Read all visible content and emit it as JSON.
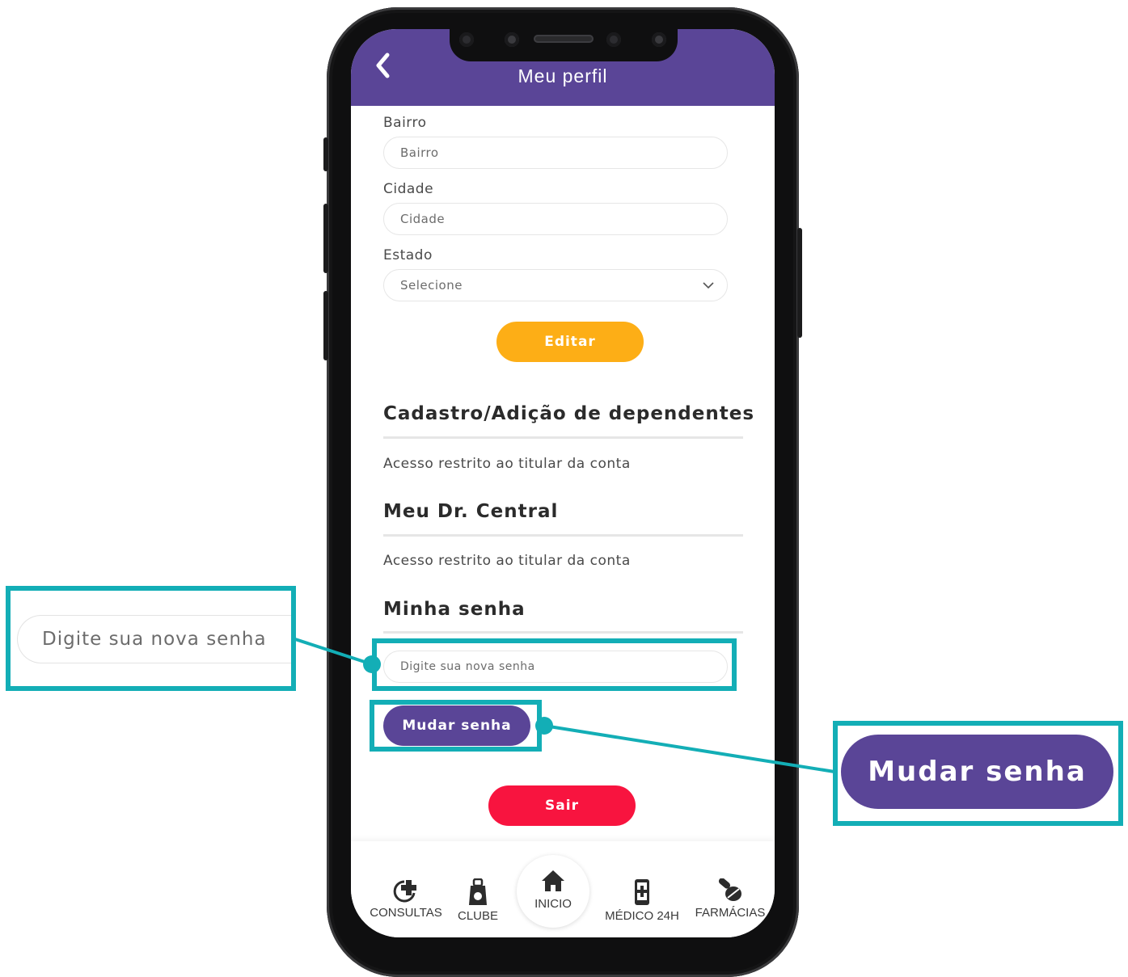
{
  "header": {
    "title": "Meu perfil"
  },
  "form": {
    "bairro": {
      "label": "Bairro",
      "placeholder": "Bairro"
    },
    "cidade": {
      "label": "Cidade",
      "placeholder": "Cidade"
    },
    "estado": {
      "label": "Estado",
      "value": "Selecione"
    },
    "edit_button": "Editar"
  },
  "sections": {
    "dependentes": {
      "title": "Cadastro/Adição de dependentes",
      "text": "Acesso restrito ao titular da conta"
    },
    "meu_dr": {
      "title": "Meu Dr. Central",
      "text": "Acesso restrito ao titular da conta"
    },
    "senha": {
      "title": "Minha senha",
      "placeholder": "Digite sua nova senha",
      "button": "Mudar senha"
    }
  },
  "logout_button": "Sair",
  "tabbar": {
    "consultas": "CONSULTAS",
    "clube": "CLUBE",
    "inicio": "INICIO",
    "medico": "MÉDICO 24H",
    "farmacias": "FARMÁCIAS"
  },
  "callouts": {
    "input_zoom": "Digite sua nova senha",
    "button_zoom": "Mudar senha"
  },
  "colors": {
    "brand_purple": "#5a4597",
    "edit_orange": "#fdae16",
    "logout_red": "#f8143f",
    "callout_teal": "#13aeb6"
  }
}
